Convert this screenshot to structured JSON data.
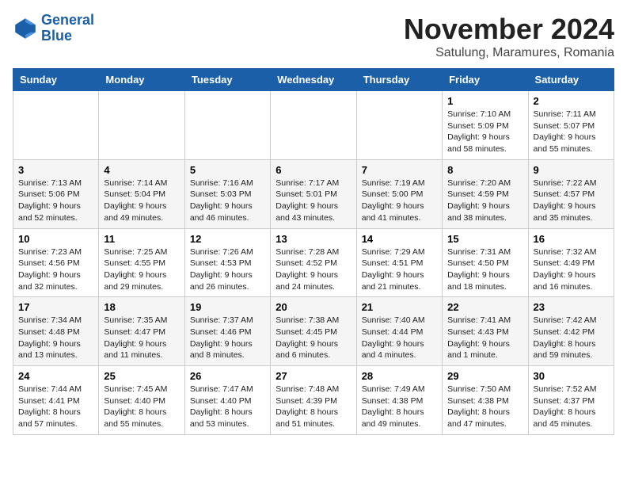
{
  "header": {
    "logo_line1": "General",
    "logo_line2": "Blue",
    "month": "November 2024",
    "location": "Satulung, Maramures, Romania"
  },
  "weekdays": [
    "Sunday",
    "Monday",
    "Tuesday",
    "Wednesday",
    "Thursday",
    "Friday",
    "Saturday"
  ],
  "weeks": [
    [
      {
        "day": "",
        "info": ""
      },
      {
        "day": "",
        "info": ""
      },
      {
        "day": "",
        "info": ""
      },
      {
        "day": "",
        "info": ""
      },
      {
        "day": "",
        "info": ""
      },
      {
        "day": "1",
        "info": "Sunrise: 7:10 AM\nSunset: 5:09 PM\nDaylight: 9 hours and 58 minutes."
      },
      {
        "day": "2",
        "info": "Sunrise: 7:11 AM\nSunset: 5:07 PM\nDaylight: 9 hours and 55 minutes."
      }
    ],
    [
      {
        "day": "3",
        "info": "Sunrise: 7:13 AM\nSunset: 5:06 PM\nDaylight: 9 hours and 52 minutes."
      },
      {
        "day": "4",
        "info": "Sunrise: 7:14 AM\nSunset: 5:04 PM\nDaylight: 9 hours and 49 minutes."
      },
      {
        "day": "5",
        "info": "Sunrise: 7:16 AM\nSunset: 5:03 PM\nDaylight: 9 hours and 46 minutes."
      },
      {
        "day": "6",
        "info": "Sunrise: 7:17 AM\nSunset: 5:01 PM\nDaylight: 9 hours and 43 minutes."
      },
      {
        "day": "7",
        "info": "Sunrise: 7:19 AM\nSunset: 5:00 PM\nDaylight: 9 hours and 41 minutes."
      },
      {
        "day": "8",
        "info": "Sunrise: 7:20 AM\nSunset: 4:59 PM\nDaylight: 9 hours and 38 minutes."
      },
      {
        "day": "9",
        "info": "Sunrise: 7:22 AM\nSunset: 4:57 PM\nDaylight: 9 hours and 35 minutes."
      }
    ],
    [
      {
        "day": "10",
        "info": "Sunrise: 7:23 AM\nSunset: 4:56 PM\nDaylight: 9 hours and 32 minutes."
      },
      {
        "day": "11",
        "info": "Sunrise: 7:25 AM\nSunset: 4:55 PM\nDaylight: 9 hours and 29 minutes."
      },
      {
        "day": "12",
        "info": "Sunrise: 7:26 AM\nSunset: 4:53 PM\nDaylight: 9 hours and 26 minutes."
      },
      {
        "day": "13",
        "info": "Sunrise: 7:28 AM\nSunset: 4:52 PM\nDaylight: 9 hours and 24 minutes."
      },
      {
        "day": "14",
        "info": "Sunrise: 7:29 AM\nSunset: 4:51 PM\nDaylight: 9 hours and 21 minutes."
      },
      {
        "day": "15",
        "info": "Sunrise: 7:31 AM\nSunset: 4:50 PM\nDaylight: 9 hours and 18 minutes."
      },
      {
        "day": "16",
        "info": "Sunrise: 7:32 AM\nSunset: 4:49 PM\nDaylight: 9 hours and 16 minutes."
      }
    ],
    [
      {
        "day": "17",
        "info": "Sunrise: 7:34 AM\nSunset: 4:48 PM\nDaylight: 9 hours and 13 minutes."
      },
      {
        "day": "18",
        "info": "Sunrise: 7:35 AM\nSunset: 4:47 PM\nDaylight: 9 hours and 11 minutes."
      },
      {
        "day": "19",
        "info": "Sunrise: 7:37 AM\nSunset: 4:46 PM\nDaylight: 9 hours and 8 minutes."
      },
      {
        "day": "20",
        "info": "Sunrise: 7:38 AM\nSunset: 4:45 PM\nDaylight: 9 hours and 6 minutes."
      },
      {
        "day": "21",
        "info": "Sunrise: 7:40 AM\nSunset: 4:44 PM\nDaylight: 9 hours and 4 minutes."
      },
      {
        "day": "22",
        "info": "Sunrise: 7:41 AM\nSunset: 4:43 PM\nDaylight: 9 hours and 1 minute."
      },
      {
        "day": "23",
        "info": "Sunrise: 7:42 AM\nSunset: 4:42 PM\nDaylight: 8 hours and 59 minutes."
      }
    ],
    [
      {
        "day": "24",
        "info": "Sunrise: 7:44 AM\nSunset: 4:41 PM\nDaylight: 8 hours and 57 minutes."
      },
      {
        "day": "25",
        "info": "Sunrise: 7:45 AM\nSunset: 4:40 PM\nDaylight: 8 hours and 55 minutes."
      },
      {
        "day": "26",
        "info": "Sunrise: 7:47 AM\nSunset: 4:40 PM\nDaylight: 8 hours and 53 minutes."
      },
      {
        "day": "27",
        "info": "Sunrise: 7:48 AM\nSunset: 4:39 PM\nDaylight: 8 hours and 51 minutes."
      },
      {
        "day": "28",
        "info": "Sunrise: 7:49 AM\nSunset: 4:38 PM\nDaylight: 8 hours and 49 minutes."
      },
      {
        "day": "29",
        "info": "Sunrise: 7:50 AM\nSunset: 4:38 PM\nDaylight: 8 hours and 47 minutes."
      },
      {
        "day": "30",
        "info": "Sunrise: 7:52 AM\nSunset: 4:37 PM\nDaylight: 8 hours and 45 minutes."
      }
    ]
  ]
}
